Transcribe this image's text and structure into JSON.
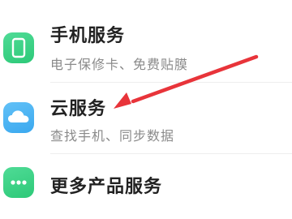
{
  "settings": {
    "items": [
      {
        "title": "手机服务",
        "subtitle": "电子保修卡、免费贴膜",
        "icon": "phone-icon",
        "icon_color": "#35cf80"
      },
      {
        "title": "云服务",
        "subtitle": "查找手机、同步数据",
        "icon": "cloud-icon",
        "icon_color": "#45afee"
      },
      {
        "title": "更多产品服务",
        "icon": "more-dots-icon",
        "icon_color": "#35cf80"
      }
    ]
  },
  "annotation": {
    "arrow_color": "#e8343a"
  }
}
